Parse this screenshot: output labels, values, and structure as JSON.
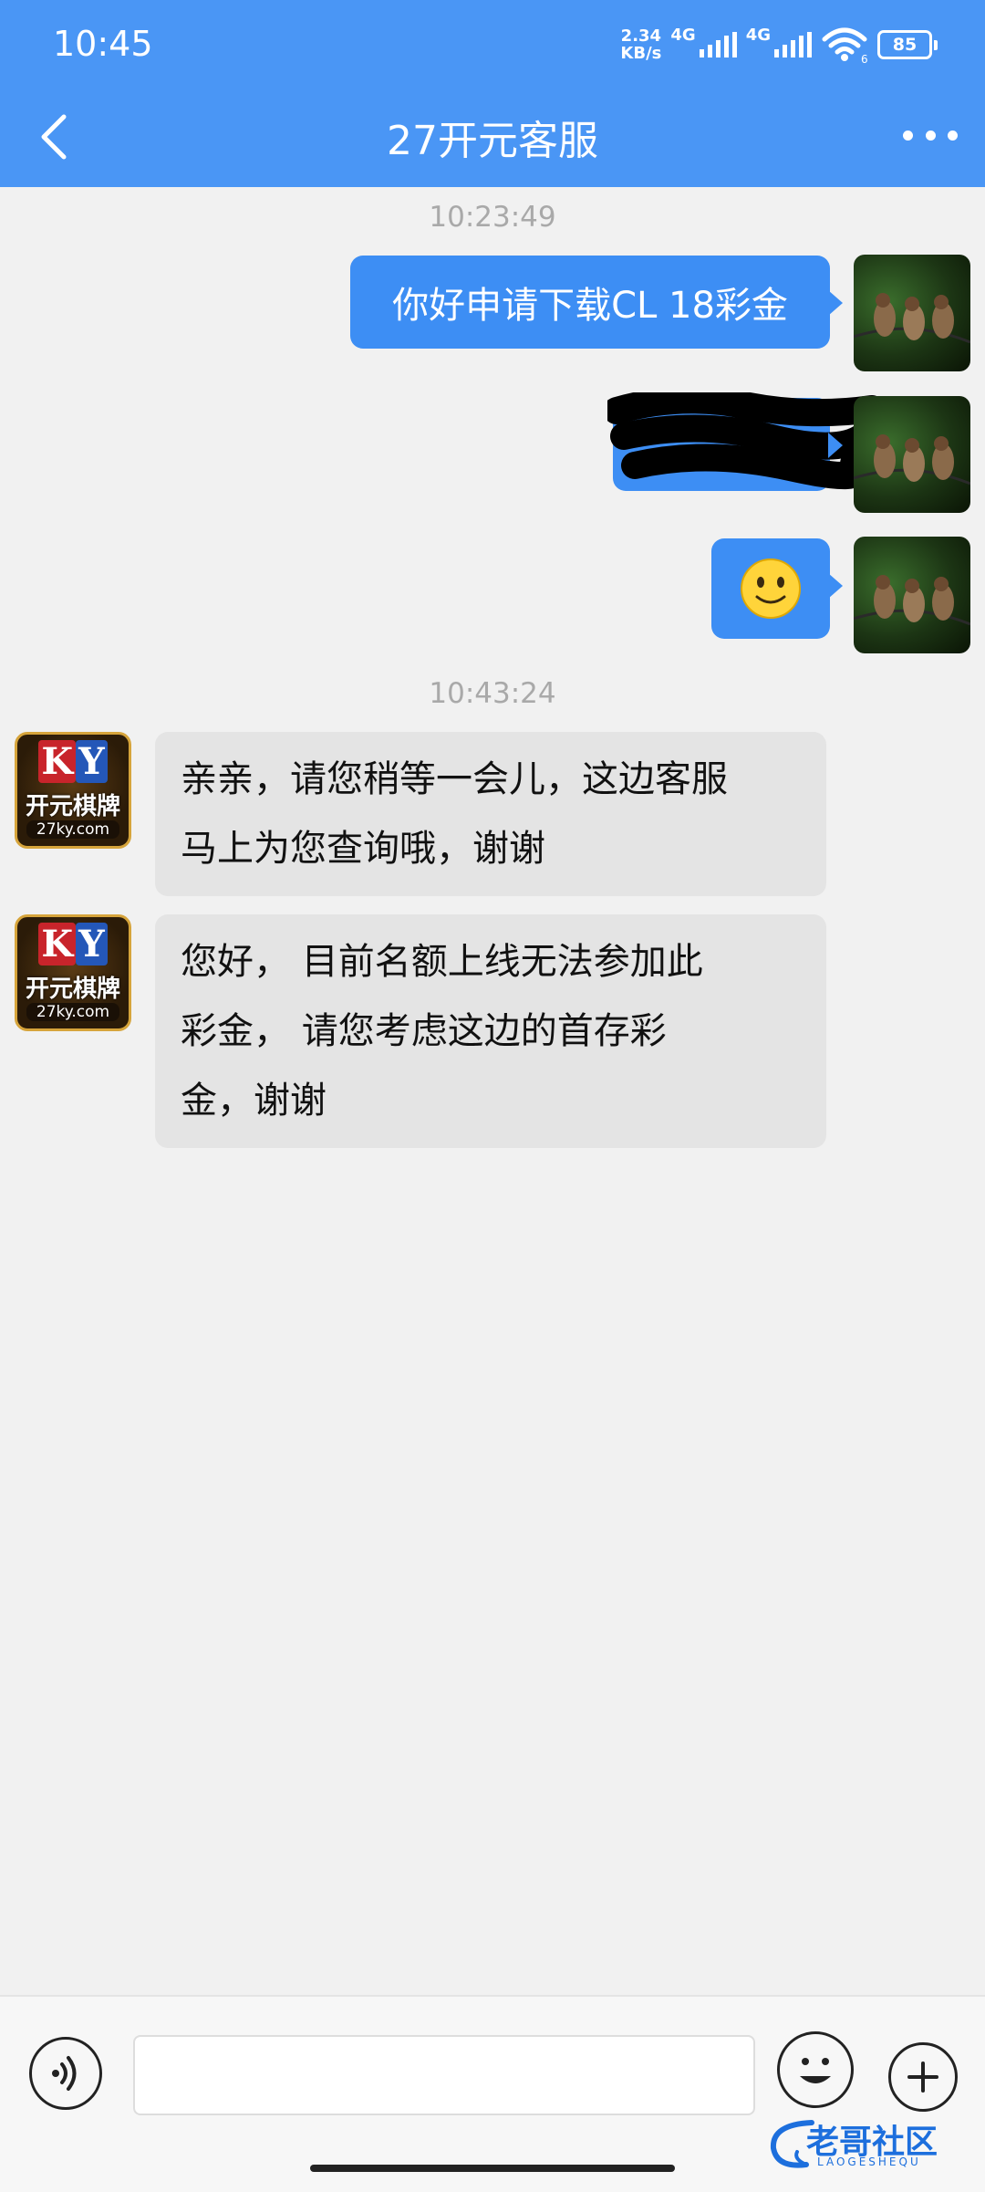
{
  "status_bar": {
    "time": "10:45",
    "net_speed_value": "2.34",
    "net_speed_unit": "KB/s",
    "net_type_1": "4G",
    "net_type_2": "4G",
    "battery": "85",
    "wifi_badge": "6"
  },
  "header": {
    "title": "27开元客服",
    "back_icon": "chevron-left-icon",
    "more_icon": "more-horizontal-icon"
  },
  "messages": [
    {
      "type": "timestamp",
      "text": "10:23:49"
    },
    {
      "type": "outgoing",
      "text": "你好申请下载CL 18彩金",
      "avatar": "sparrows-photo"
    },
    {
      "type": "outgoing",
      "text": "",
      "redacted": true,
      "avatar": "sparrows-photo"
    },
    {
      "type": "outgoing",
      "text": "",
      "emoji": "smiling-face-emoji",
      "avatar": "sparrows-photo"
    },
    {
      "type": "timestamp",
      "text": "10:43:24"
    },
    {
      "type": "incoming",
      "lines": [
        "亲亲，请您稍等一会儿，这边客服",
        "马上为您查询哦，谢谢"
      ],
      "avatar": {
        "logo_k": "K",
        "logo_y": "Y",
        "name": "开元棋牌",
        "url": "27ky.com"
      }
    },
    {
      "type": "incoming",
      "lines": [
        "您好， 目前名额上线无法参加此",
        "彩金， 请您考虑这边的首存彩",
        "金，谢谢"
      ],
      "avatar": {
        "logo_k": "K",
        "logo_y": "Y",
        "name": "开元棋牌",
        "url": "27ky.com"
      }
    }
  ],
  "input_bar": {
    "voice_icon": "voice-input-icon",
    "input_value": "",
    "emoji_icon": "emoji-icon",
    "plus_icon": "plus-icon"
  },
  "watermark": {
    "text": "老哥社区",
    "subtext": "LAOGESHEQU"
  },
  "colors": {
    "header": "#4a96f5",
    "bubble_out": "#3d8ef4",
    "bubble_in": "#e4e4e4",
    "background": "#f1f1f1"
  }
}
